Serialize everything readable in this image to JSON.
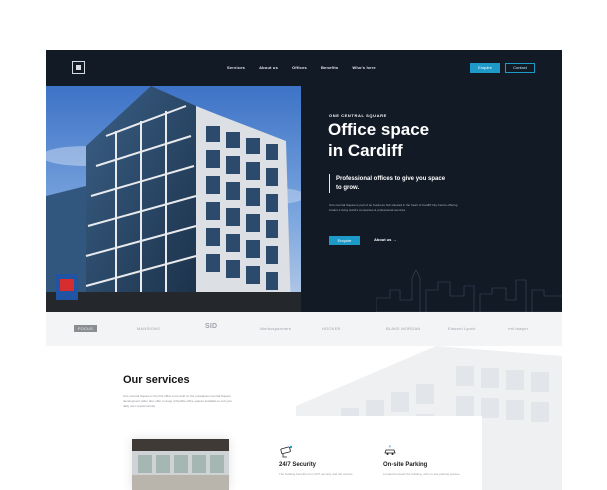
{
  "nav": {
    "links": [
      "Services",
      "About us",
      "Offices",
      "Benefits",
      "Who's here"
    ],
    "enquire_label": "Enquire",
    "contact_label": "Contact"
  },
  "hero": {
    "eyebrow": "ONE CENTRAL SQUARE",
    "title_line1": "Office space",
    "title_line2": "in Cardiff",
    "tagline": "Professional offices to give you space to grow.",
    "description": "One Central Square is part of an business hub situated in the heart of Cardiff City Centre offering instant a living world's companies & professional services.",
    "cta_label": "Enquire",
    "about_label": "About us →"
  },
  "logos": [
    "FOCUS",
    "MANSIONS",
    "SID",
    "Nimbuspartners",
    "HOOKER",
    "BLAKE MORGAN",
    "Edward Lynch",
    "rml lawyer"
  ],
  "services": {
    "heading": "Our services",
    "description": "One Central Square is the first office to be built on the prestigious Central Square development (after also offer a range of flexible office spaces available to suit your daily user requirements).",
    "cards": [
      {
        "label": "24/7 Security",
        "text": "The building benefits from 24/7 security and fob access."
      },
      {
        "label": "On-site Parking",
        "text": "Located beneath the building, with on-site parking spaces."
      }
    ]
  },
  "colors": {
    "hero_bg": "#121a26",
    "accent": "#1e9ac9",
    "strip_bg": "#f3f4f6"
  }
}
